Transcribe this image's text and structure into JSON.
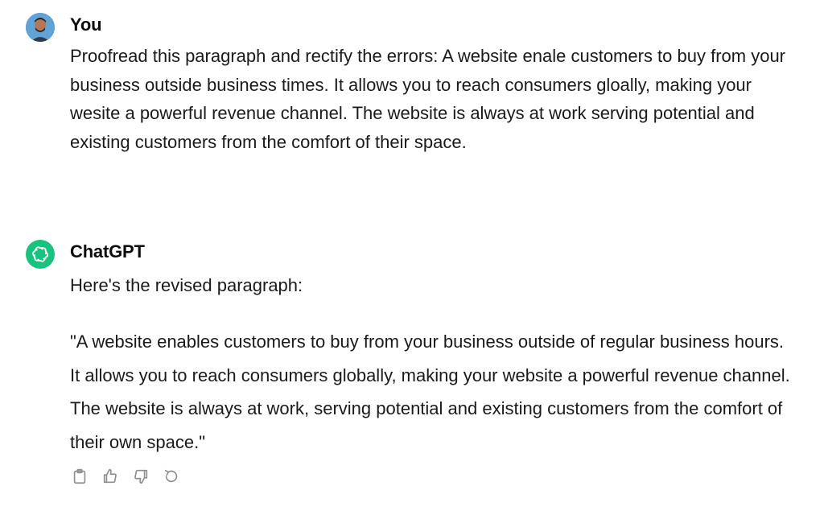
{
  "user_message": {
    "author": "You",
    "text": "Proofread this paragraph and rectify the errors: A website enale customers to buy from your business outside business times. It allows you to reach consumers gloally, making your wesite a powerful revenue channel. The website is always at work serving potential and existing customers from the comfort of their space.",
    "avatar": "user-avatar-icon"
  },
  "assistant_message": {
    "author": "ChatGPT",
    "intro": "Here's the revised paragraph:",
    "quote": "\"A website enables customers to buy from your business outside of regular business hours. It allows you to reach consumers globally, making your website a powerful revenue channel. The website is always at work, serving potential and existing customers from the comfort of their own space.\"",
    "avatar": "chatgpt-logo-icon",
    "actions": [
      "copy-icon",
      "thumbs-up-icon",
      "thumbs-down-icon",
      "regenerate-icon"
    ]
  },
  "colors": {
    "bot_avatar": "#19c37d",
    "text": "#1a1a1a",
    "icon": "#8e8e8e"
  }
}
